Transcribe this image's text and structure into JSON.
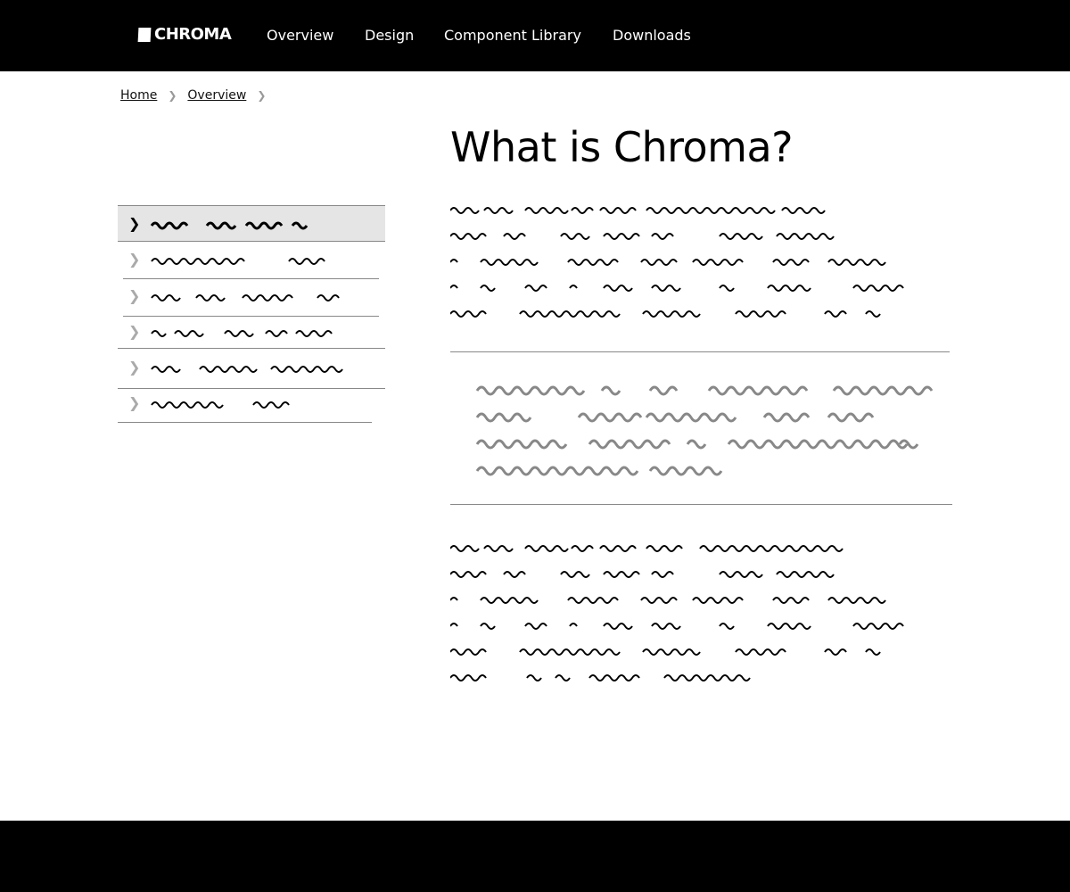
{
  "brand": {
    "name": "CHROMA"
  },
  "nav": {
    "items": [
      {
        "label": "Overview"
      },
      {
        "label": "Design"
      },
      {
        "label": "Component Library"
      },
      {
        "label": "Downloads"
      }
    ]
  },
  "breadcrumb": {
    "items": [
      {
        "label": "Home"
      },
      {
        "label": "Overview"
      }
    ]
  },
  "main": {
    "title": "What is Chroma?"
  },
  "sidebar": {
    "active_index": 0,
    "items": [
      {
        "icon": "chevron-right-icon"
      },
      {
        "icon": "chevron-right-icon"
      },
      {
        "icon": "chevron-right-icon"
      },
      {
        "icon": "chevron-right-icon"
      },
      {
        "icon": "chevron-right-icon"
      },
      {
        "icon": "chevron-right-icon"
      }
    ]
  },
  "colors": {
    "header_bg": "#000000",
    "footer_bg": "#000000",
    "active_item_bg": "#e5e5e5",
    "quote_text": "#888888"
  }
}
